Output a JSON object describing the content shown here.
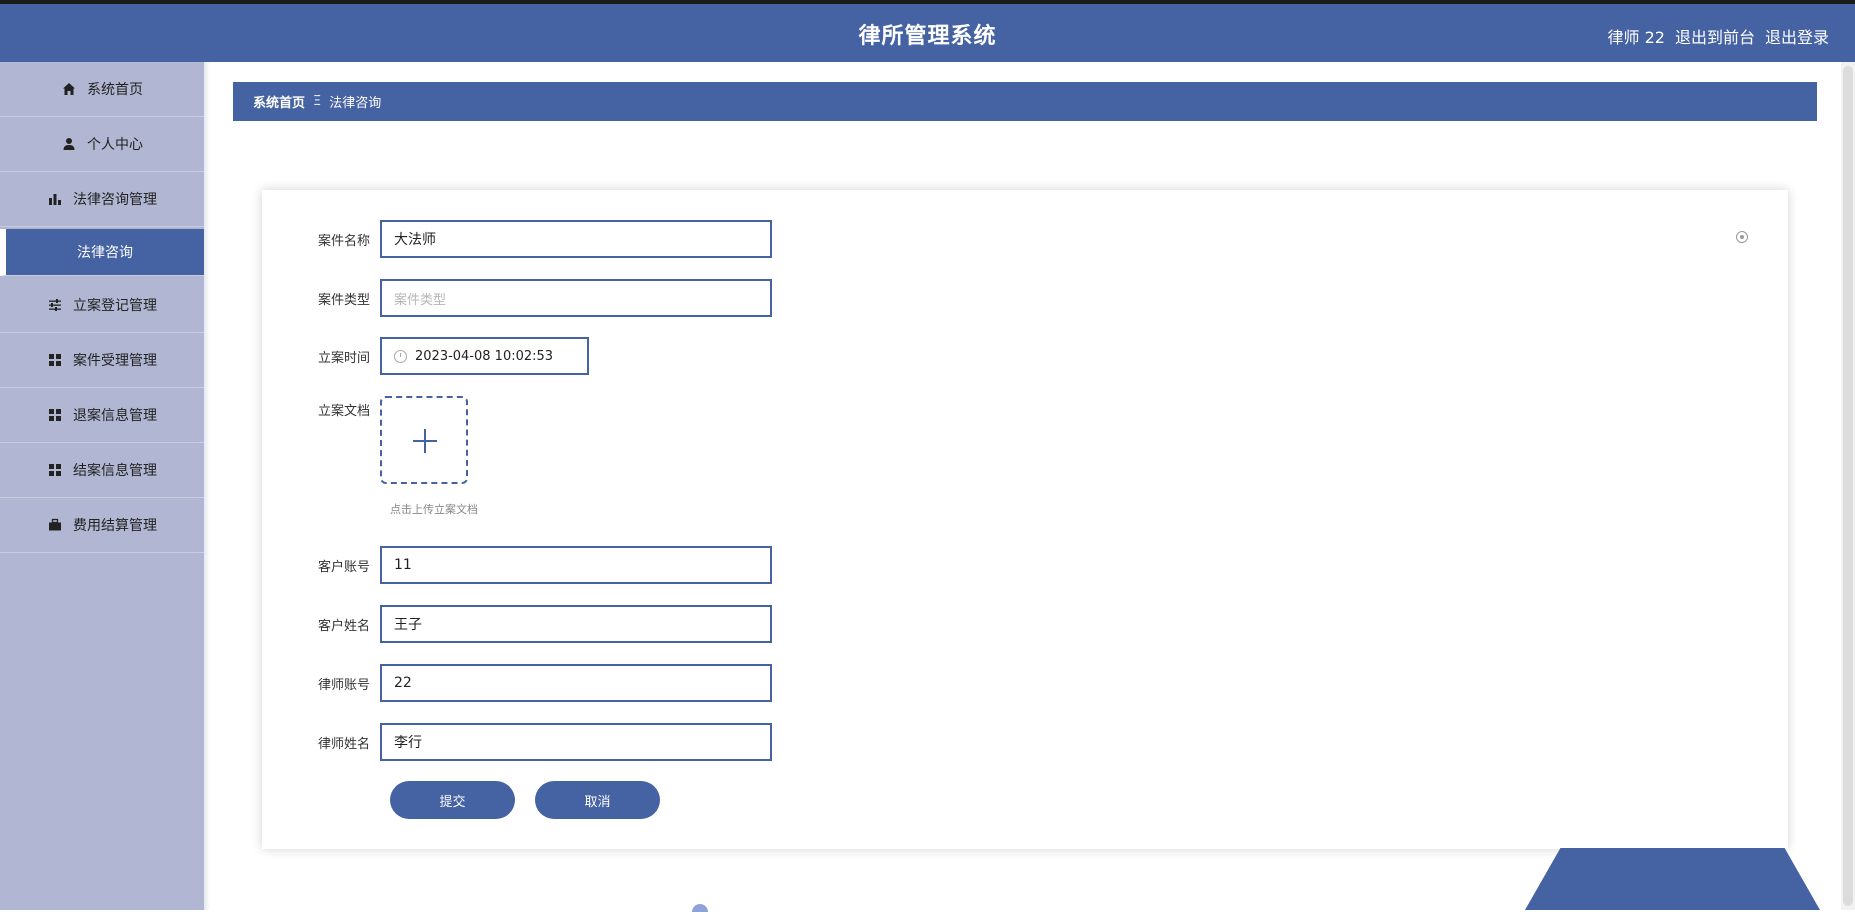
{
  "header": {
    "title": "律所管理系统",
    "user_label": "律师 22",
    "to_front": "退出到前台",
    "logout": "退出登录"
  },
  "sidebar": {
    "items": [
      {
        "label": "系统首页",
        "icon": "home-icon"
      },
      {
        "label": "个人中心",
        "icon": "user-icon"
      },
      {
        "label": "法律咨询管理",
        "icon": "bar-chart-icon"
      },
      {
        "label": "法律咨询",
        "icon": "",
        "active": true
      },
      {
        "label": "立案登记管理",
        "icon": "sliders-icon"
      },
      {
        "label": "案件受理管理",
        "icon": "grid-icon"
      },
      {
        "label": "退案信息管理",
        "icon": "grid-icon"
      },
      {
        "label": "结案信息管理",
        "icon": "grid-icon"
      },
      {
        "label": "费用结算管理",
        "icon": "briefcase-icon"
      }
    ]
  },
  "breadcrumb": {
    "home": "系统首页",
    "separator": "Ξ",
    "current": "法律咨询"
  },
  "form": {
    "case_name": {
      "label": "案件名称",
      "value": "大法师"
    },
    "case_type": {
      "label": "案件类型",
      "placeholder": "案件类型"
    },
    "filing_time": {
      "label": "立案时间",
      "value": "2023-04-08 10:02:53"
    },
    "filing_doc": {
      "label": "立案文档",
      "hint": "点击上传立案文档"
    },
    "client_account": {
      "label": "客户账号",
      "value": "11"
    },
    "client_name": {
      "label": "客户姓名",
      "value": "王子"
    },
    "lawyer_account": {
      "label": "律师账号",
      "value": "22"
    },
    "lawyer_name": {
      "label": "律师姓名",
      "value": "李行"
    },
    "submit": "提交",
    "cancel": "取消"
  },
  "colors": {
    "primary": "#4562a3",
    "sidebar_bg": "#b1b7d2"
  }
}
